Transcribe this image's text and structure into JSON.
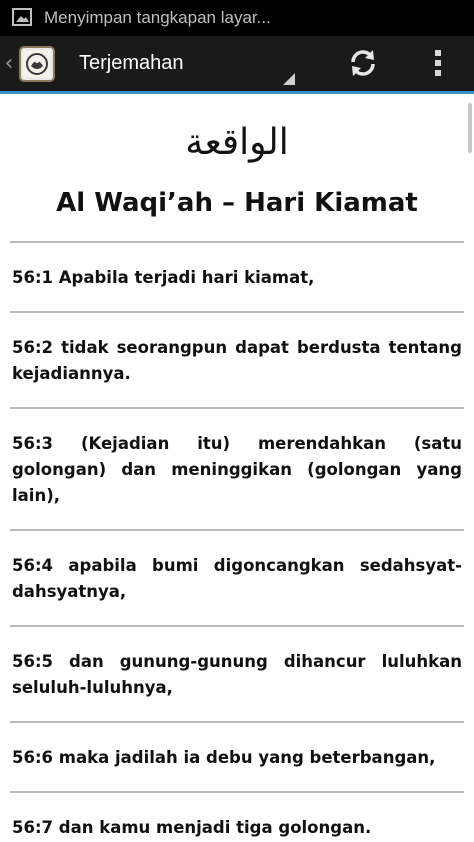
{
  "status_bar": {
    "notification_text": "Menyimpan tangkapan layar..."
  },
  "action_bar": {
    "title": "Terjemahan",
    "icons": [
      "screenshot-icon",
      "app-logo-icon",
      "refresh-icon",
      "overflow-menu-icon"
    ],
    "accent_color": "#3a8fc4"
  },
  "surah": {
    "arabic_name": "الواقعة",
    "title": "Al Waqi’ah – Hari Kiamat"
  },
  "verses": [
    {
      "text": "56:1 Apabila terjadi hari kiamat,"
    },
    {
      "text": "56:2 tidak seorangpun dapat berdusta tentang kejadiannya."
    },
    {
      "text": "56:3 (Kejadian itu) merendahkan (satu golongan) dan meninggikan (golongan yang lain),"
    },
    {
      "text": "56:4 apabila bumi digoncangkan sedahsyat-dahsyatnya,"
    },
    {
      "text": "56:5 dan gunung-gunung dihancur luluhkan seluluh-luluhnya,"
    },
    {
      "text": "56:6 maka jadilah ia debu yang beterbangan,"
    },
    {
      "text": "56:7 dan kamu menjadi tiga golongan."
    }
  ]
}
